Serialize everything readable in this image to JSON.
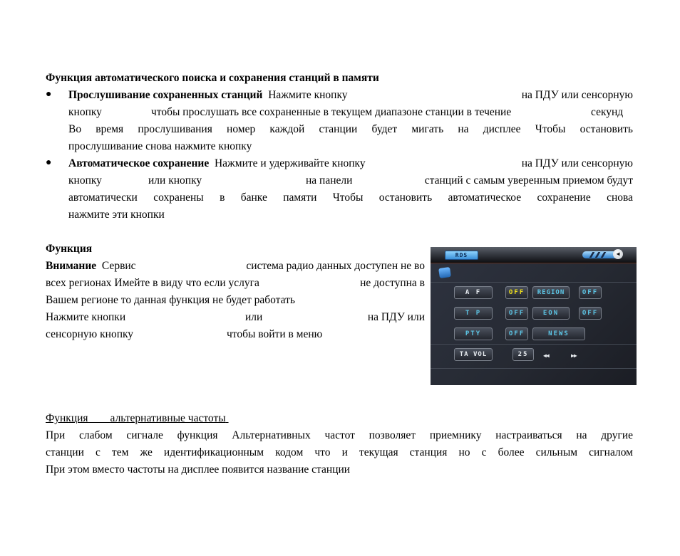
{
  "section1": {
    "heading": "Функция автоматического поиска и сохранения станций в памяти",
    "bullet1": {
      "bold": "Прослушивание сохраненных станций",
      "line1_rest": "Нажмите кнопку",
      "line1_tail": "на ПДУ или сенсорную",
      "line2a": "кнопку",
      "line2b": "чтобы прослушать все сохраненные в текущем диапазоне станции в течение",
      "line2c": "секунд",
      "line3": "Во время прослушивания номер каждой станции будет мигать на дисплее Чтобы остановить",
      "line4": "прослушивание снова нажмите кнопку"
    },
    "bullet2": {
      "bold": "Автоматическое сохранение",
      "line1_rest": "Нажмите и удерживайте кнопку",
      "line1_tail": "на ПДУ или сенсорную",
      "line2a": "кнопку",
      "line2b": "или кнопку",
      "line2c": "на панели",
      "line2d": "станций с самым уверенным приемом будут",
      "line3": "автоматически сохранены в банке памяти Чтобы остановить автоматическое сохранение снова",
      "line4": "нажмите эти кнопки"
    },
    "bullet_symbol": "●"
  },
  "section2": {
    "heading": "Функция",
    "note_label": "Внимание",
    "line1a": "Сервис",
    "line1b": "система радио данных доступен не во",
    "line2a": "всех регионах Имейте в виду что если услуга",
    "line2b": "не доступна в",
    "line3": "Вашем регионе то данная функция не будет работать",
    "line4a": "Нажмите кнопки",
    "line4b": "или",
    "line4c": "на ПДУ или",
    "line5a": "сенсорную кнопку",
    "line5b": "чтобы войти в меню"
  },
  "rds_panel": {
    "tab_label": "RDS",
    "back_icon": "◀",
    "rows": [
      {
        "label": "A F",
        "value": "OFF",
        "option": "REGION",
        "option_value": "OFF"
      },
      {
        "label": "T P",
        "value": "OFF",
        "option": "EON",
        "option_value": "OFF"
      },
      {
        "label": "PTY",
        "value": "OFF",
        "option": "NEWS"
      }
    ],
    "ta_vol_label": "TA VOL",
    "ta_vol_value": "25",
    "prev_icon": "◀◀",
    "next_icon": "▶▶"
  },
  "section3": {
    "heading_a": "Функция",
    "heading_b": "альтернативные частоты",
    "line1": "При слабом сигнале функция Альтернативных частот позволяет приемнику настраиваться на другие",
    "line2": "станции с тем же идентификационным кодом что и текущая станция но с более сильным сигналом",
    "line3": "При этом вместо частоты на дисплее появится название станции"
  }
}
